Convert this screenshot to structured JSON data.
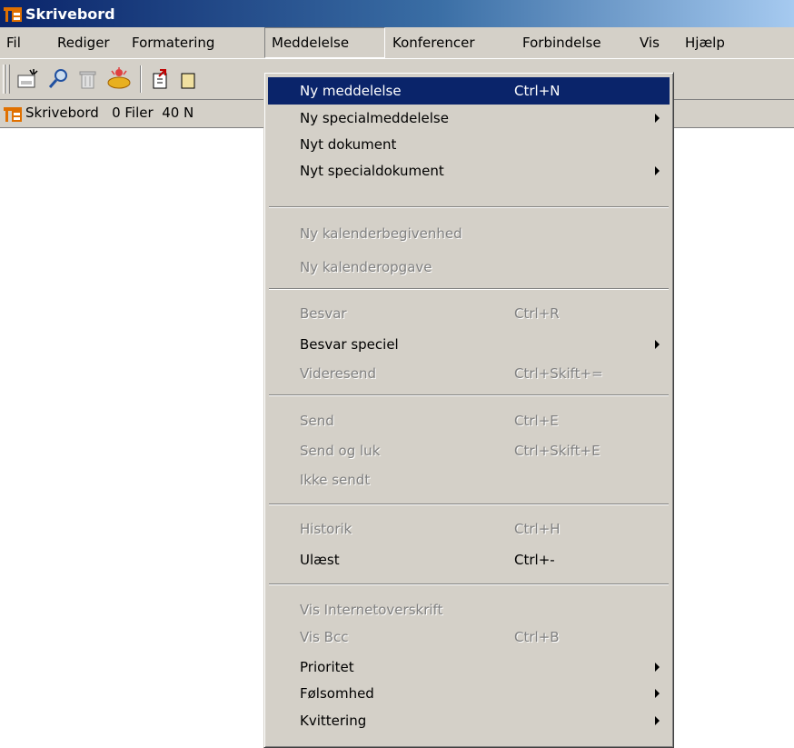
{
  "window": {
    "title": "Skrivebord"
  },
  "menubar": {
    "items": [
      {
        "label": "Fil"
      },
      {
        "label": "Rediger"
      },
      {
        "label": "Formatering"
      },
      {
        "label": "Meddelelse"
      },
      {
        "label": "Konferencer"
      },
      {
        "label": "Forbindelse"
      },
      {
        "label": "Vis"
      },
      {
        "label": "Hjælp"
      }
    ]
  },
  "toolbar": {
    "icons": [
      "new-message-icon",
      "search-icon",
      "trash-icon",
      "keys-icon",
      "reply-icon"
    ]
  },
  "pathbar": {
    "text": "Skrivebord   0 Filer  40 N"
  },
  "dropdown": {
    "items": [
      {
        "label": "Ny meddelelse",
        "shortcut": "Ctrl+N"
      },
      {
        "label": "Ny specialmeddelelse",
        "shortcut": ""
      },
      {
        "label": "Nyt dokument",
        "shortcut": ""
      },
      {
        "label": "Nyt specialdokument",
        "shortcut": ""
      },
      {
        "label": "Ny kalenderbegivenhed",
        "shortcut": ""
      },
      {
        "label": "Ny kalenderopgave",
        "shortcut": ""
      },
      {
        "label": "Besvar",
        "shortcut": "Ctrl+R"
      },
      {
        "label": "Besvar speciel",
        "shortcut": ""
      },
      {
        "label": "Videresend",
        "shortcut": "Ctrl+Skift+="
      },
      {
        "label": "Send",
        "shortcut": "Ctrl+E"
      },
      {
        "label": "Send og luk",
        "shortcut": "Ctrl+Skift+E"
      },
      {
        "label": "Ikke sendt",
        "shortcut": ""
      },
      {
        "label": "Historik",
        "shortcut": "Ctrl+H"
      },
      {
        "label": "Ulæst",
        "shortcut": "Ctrl+-"
      },
      {
        "label": "Vis Internetoverskrift",
        "shortcut": ""
      },
      {
        "label": "Vis Bcc",
        "shortcut": "Ctrl+B"
      },
      {
        "label": "Prioritet",
        "shortcut": ""
      },
      {
        "label": "Følsomhed",
        "shortcut": ""
      },
      {
        "label": "Kvittering",
        "shortcut": ""
      }
    ]
  },
  "colors": {
    "highlight": "#0a246a",
    "menu_bg": "#d4d0c8",
    "disabled_text": "#808080"
  }
}
